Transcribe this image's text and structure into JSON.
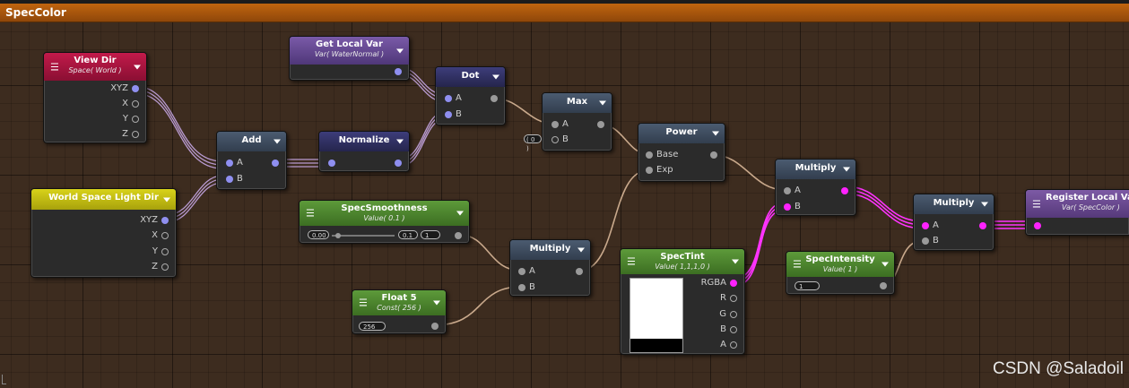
{
  "window": {
    "title": "SpecColor"
  },
  "nodes": {
    "view_dir": {
      "title": "View Dir",
      "subtitle": "Space( World )",
      "outputs": [
        "XYZ",
        "X",
        "Y",
        "Z"
      ]
    },
    "get_local_var": {
      "title": "Get Local Var",
      "subtitle": "Var( WaterNormal )"
    },
    "dot": {
      "title": "Dot",
      "inputs": [
        "A",
        "B"
      ]
    },
    "max": {
      "title": "Max",
      "inputs": [
        "A",
        "B"
      ],
      "b_value": "( 0 )"
    },
    "add": {
      "title": "Add",
      "inputs": [
        "A",
        "B"
      ]
    },
    "normalize": {
      "title": "Normalize"
    },
    "power": {
      "title": "Power",
      "inputs": [
        "Base",
        "Exp"
      ]
    },
    "world_light": {
      "title": "World Space Light Dir",
      "outputs": [
        "XYZ",
        "X",
        "Y",
        "Z"
      ]
    },
    "spec_smoothness": {
      "title": "SpecSmoothness",
      "subtitle": "Value( 0.1 )",
      "min": "0.00",
      "value": "0.1",
      "max": "1"
    },
    "multiply1": {
      "title": "Multiply",
      "inputs": [
        "A",
        "B"
      ]
    },
    "float5": {
      "title": "Float 5",
      "subtitle": "Const( 256 )",
      "value": "256"
    },
    "spec_tint": {
      "title": "SpecTint",
      "subtitle": "Value( 1,1,1,0 )",
      "outputs": [
        "RGBA",
        "R",
        "G",
        "B",
        "A"
      ]
    },
    "multiply2": {
      "title": "Multiply",
      "inputs": [
        "A",
        "B"
      ]
    },
    "spec_intensity": {
      "title": "SpecIntensity",
      "subtitle": "Value( 1 )",
      "value": "1"
    },
    "multiply3": {
      "title": "Multiply",
      "inputs": [
        "A",
        "B"
      ]
    },
    "register_local_var": {
      "title": "Register Local Var",
      "subtitle": "Var( SpecColor )"
    }
  },
  "watermark": "CSDN @Saladoil",
  "colors": {
    "titlebar": "#b25c0d",
    "vector_port": "#8f8ff0",
    "color_port": "#ff22ff",
    "float_port": "#9a9a9a"
  },
  "icons": {
    "menu": "hamburger-icon",
    "dropdown": "chevron-down-icon"
  }
}
